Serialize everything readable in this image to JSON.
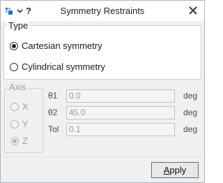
{
  "window": {
    "title": "Symmetry Restraints",
    "help_glyph": "?",
    "icons": [
      "app-icon",
      "chevron-down-icon",
      "close-icon"
    ]
  },
  "type_group": {
    "legend": "Type",
    "options": [
      {
        "label": "Cartesian symmetry",
        "selected": true
      },
      {
        "label": "Cylindrical symmetry",
        "selected": false
      }
    ]
  },
  "axis_group": {
    "legend": "Axis",
    "enabled": false,
    "options": [
      {
        "label": "X",
        "selected": false
      },
      {
        "label": "Y",
        "selected": false
      },
      {
        "label": "Z",
        "selected": true
      }
    ]
  },
  "params": {
    "theta1": {
      "label": "θ1",
      "value": "0.0",
      "unit": "deg",
      "enabled": false
    },
    "theta2": {
      "label": "θ2",
      "value": "45.0",
      "unit": "deg",
      "enabled": false
    },
    "tol": {
      "label": "Tol",
      "value": "0.1",
      "unit": "deg",
      "enabled": false
    }
  },
  "footer": {
    "apply_first": "A",
    "apply_rest": "pply"
  },
  "colors": {
    "app_icon_blue": "#1f73c7",
    "disabled_text": "#a0a0a0"
  }
}
